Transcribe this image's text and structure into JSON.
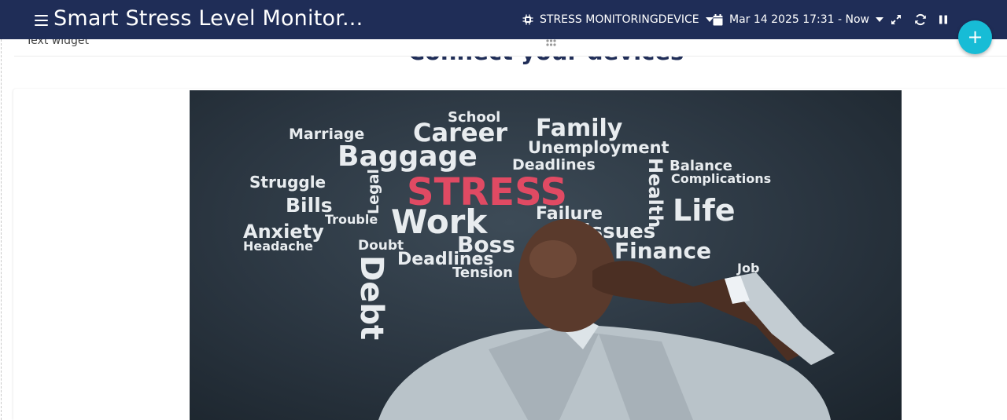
{
  "header": {
    "title": "Smart Stress Level Monitor...",
    "device": "STRESS MONITORINGDEVICE",
    "timewindow": "Mar 14 2025 17:31 - Now",
    "add_label": "+"
  },
  "widget": {
    "title": "Text widget",
    "heading": "Connect your devices"
  },
  "image": {
    "words": {
      "school": "School",
      "marriage": "Marriage",
      "career": "Career",
      "family": "Family",
      "baggage": "Baggage",
      "unemployment": "Unemployment",
      "deadlines1": "Deadlines",
      "balance": "Balance",
      "struggle": "Struggle",
      "legal": "Legal",
      "stress": "STRESS",
      "complications": "Complications",
      "bills": "Bills",
      "trouble": "Trouble",
      "work": "Work",
      "failure": "Failure",
      "life": "Life",
      "anxiety": "Anxiety",
      "issues": "Issues",
      "headache": "Headache",
      "doubt": "Doubt",
      "boss": "Boss",
      "finance": "Finance",
      "deadlines2": "Deadlines",
      "job": "Job",
      "tension": "Tension",
      "debt": "Debt",
      "health": "Health"
    }
  },
  "colors": {
    "header_bg": "#1f2d57",
    "accent": "#17bcd6",
    "heading": "#1f2d57",
    "stress_word": "#e04a63"
  }
}
